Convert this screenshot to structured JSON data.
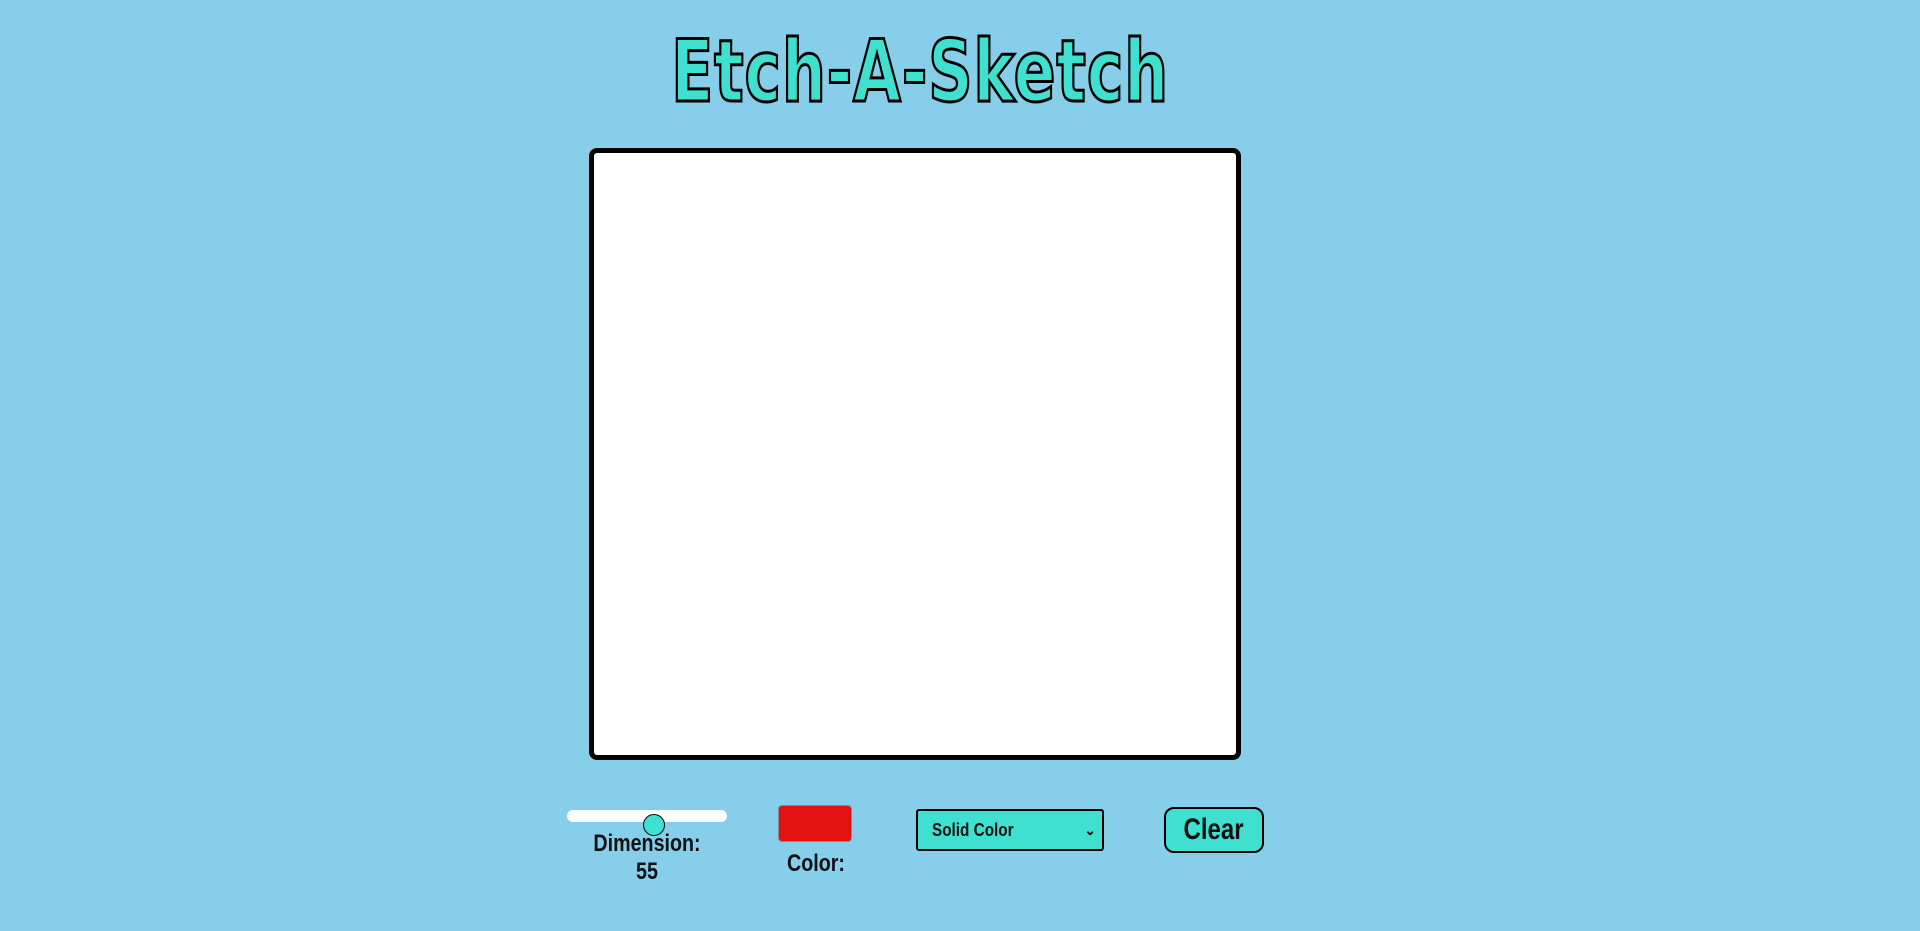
{
  "header": {
    "title": "Etch-A-Sketch"
  },
  "controls": {
    "dimension": {
      "label": "Dimension: 55",
      "value": 55,
      "min": 1,
      "max": 100
    },
    "color": {
      "label": "Color:",
      "value": "#e31212"
    },
    "mode": {
      "selected": "Solid Color"
    },
    "clear_label": "Clear"
  },
  "colors": {
    "background": "#87ceeb",
    "accent": "#40e0d0",
    "board": "#ffffff",
    "border": "#000000"
  }
}
